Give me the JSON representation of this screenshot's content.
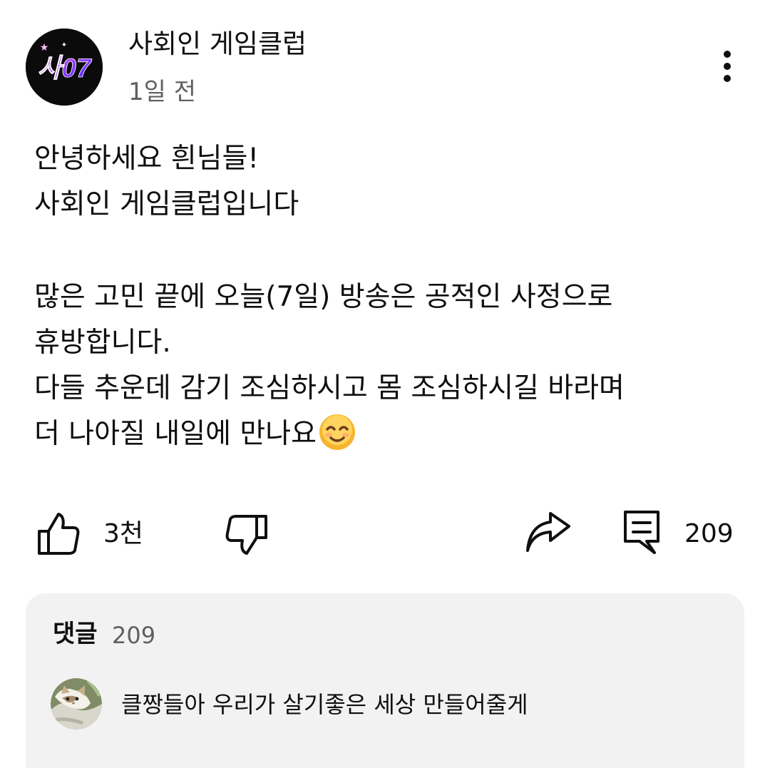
{
  "channel": {
    "name": "사회인 게임클럽",
    "time": "1일 전",
    "avatar_text": "사07"
  },
  "post": {
    "lines": [
      "안녕하세요 흰님들!",
      "사회인 게임클럽입니다",
      "",
      "많은 고민 끝에 오늘(7일) 방송은 공적인 사정으로",
      "휴방합니다.",
      "다들 추운데 감기 조심하시고 몸 조심하시길 바라며",
      "더 나아질 내일에 만나요"
    ],
    "emoji": "smiling-face-emoji"
  },
  "actions": {
    "like_count": "3천",
    "comment_count": "209"
  },
  "comments": {
    "title": "댓글",
    "count": "209",
    "preview_text": "클짱들아 우리가 살기좋은 세상 만들어줄게"
  },
  "icons": [
    "more-vertical-icon",
    "thumbs-up-icon",
    "thumbs-down-icon",
    "share-icon",
    "comment-icon",
    "cat-avatar"
  ],
  "colors": {
    "text": "#0f0f0f",
    "secondary_text": "#606060",
    "comments_background": "#f2f2f2",
    "avatar_background": "#0b0b0b",
    "avatar_accent": "#8b3dff"
  }
}
